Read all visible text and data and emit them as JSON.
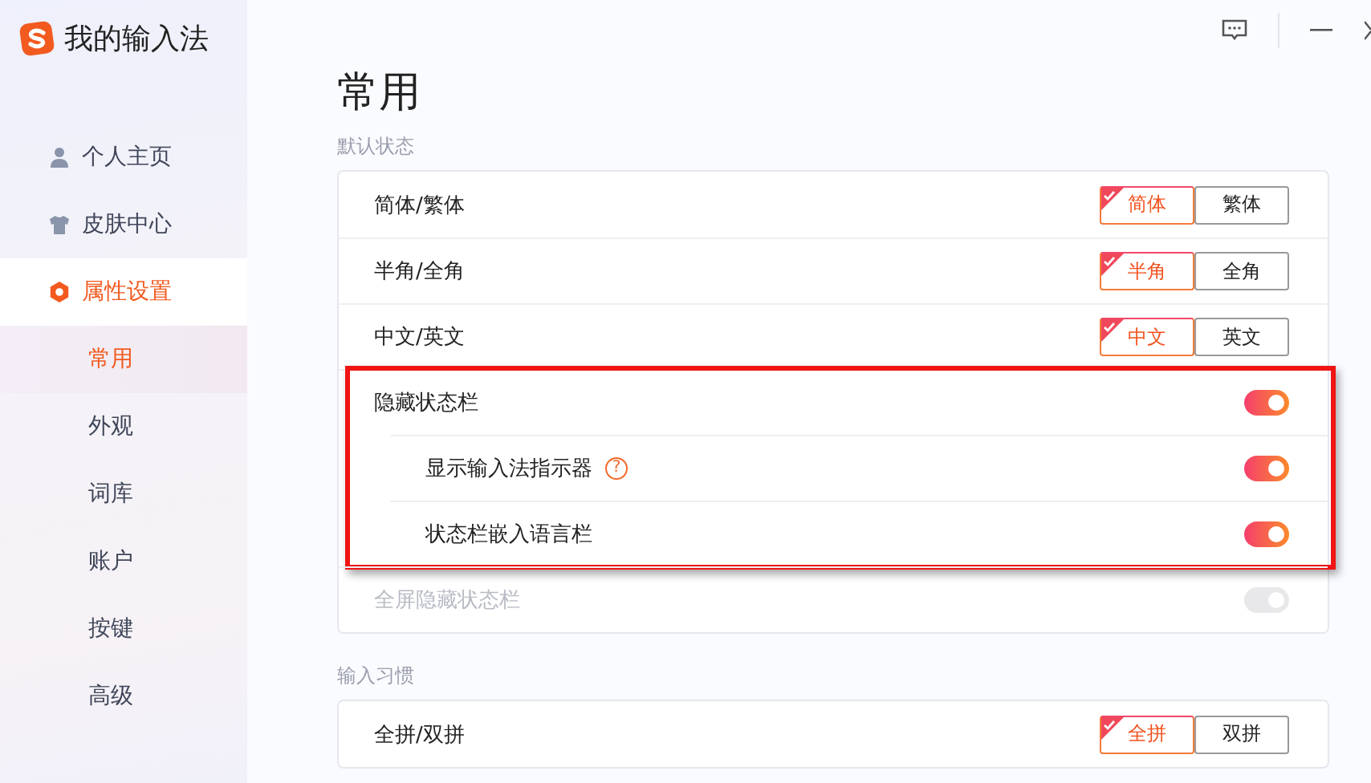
{
  "app": {
    "title": "我的输入法"
  },
  "sidebar": {
    "items": [
      {
        "label": "个人主页",
        "kind": "main",
        "selected": false
      },
      {
        "label": "皮肤中心",
        "kind": "main",
        "selected": false
      },
      {
        "label": "属性设置",
        "kind": "main",
        "selected": true
      },
      {
        "label": "常用",
        "kind": "sub",
        "selected": true
      },
      {
        "label": "外观",
        "kind": "sub",
        "selected": false
      },
      {
        "label": "词库",
        "kind": "sub",
        "selected": false
      },
      {
        "label": "账户",
        "kind": "sub",
        "selected": false
      },
      {
        "label": "按键",
        "kind": "sub",
        "selected": false
      },
      {
        "label": "高级",
        "kind": "sub",
        "selected": false
      }
    ]
  },
  "page": {
    "title": "常用"
  },
  "sections": [
    {
      "label": "默认状态",
      "rows": [
        {
          "kind": "segmented",
          "label": "简体/繁体",
          "highlighted": false,
          "options": [
            {
              "label": "简体",
              "selected": true
            },
            {
              "label": "繁体",
              "selected": false
            }
          ]
        },
        {
          "kind": "segmented",
          "label": "半角/全角",
          "highlighted": false,
          "options": [
            {
              "label": "半角",
              "selected": true
            },
            {
              "label": "全角",
              "selected": false
            }
          ]
        },
        {
          "kind": "segmented",
          "label": "中文/英文",
          "highlighted": false,
          "options": [
            {
              "label": "中文",
              "selected": true
            },
            {
              "label": "英文",
              "selected": false
            }
          ]
        },
        {
          "kind": "toggle",
          "label": "隐藏状态栏",
          "highlighted": true,
          "on": true,
          "disabled": false,
          "children": [
            {
              "kind": "toggle",
              "label": "显示输入法指示器",
              "help": "?",
              "on": true,
              "disabled": false
            },
            {
              "kind": "toggle",
              "label": "状态栏嵌入语言栏",
              "on": true,
              "disabled": false
            }
          ]
        },
        {
          "kind": "toggle",
          "label": "全屏隐藏状态栏",
          "highlighted": false,
          "on": true,
          "disabled": true
        }
      ]
    },
    {
      "label": "输入习惯",
      "rows": [
        {
          "kind": "segmented",
          "label": "全拼/双拼",
          "highlighted": false,
          "options": [
            {
              "label": "全拼",
              "selected": true
            },
            {
              "label": "双拼",
              "selected": false
            }
          ]
        }
      ]
    }
  ]
}
